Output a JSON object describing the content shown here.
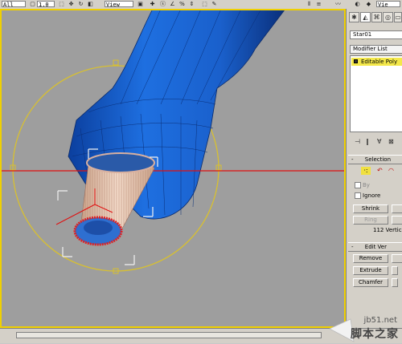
{
  "toolbar": {
    "filter_value": "All",
    "spinner_value": "1.0",
    "view_value": "View",
    "right_view_value": "Vie"
  },
  "command_panel": {
    "object_name": "Star01",
    "modifier_list_label": "Modifier List",
    "stack_item": "Editable Poly",
    "selection_rollout_title": "Selection",
    "by_label": "By",
    "ignore_label": "Ignore",
    "shrink_label": "Shrink",
    "ring_label": "Ring",
    "status_text": "112 Vertic",
    "edit_rollout_title": "Edit Ver",
    "remove_label": "Remove",
    "extrude_label": "Extrude",
    "chamfer_label": "Chamfer"
  },
  "watermark": {
    "url": "jb51.net",
    "text": "脚本之家"
  },
  "colors": {
    "model_blue": "#1e6fe0",
    "gizmo_yellow": "#d8c030",
    "axis_red": "#e01010",
    "selection_red": "#e02020",
    "viewport_gray": "#9e9e9e"
  },
  "icons": [
    "hammer-icon",
    "arrow-icon",
    "rotate-icon",
    "scale-icon",
    "pin-icon",
    "vertex-icon",
    "edge-icon"
  ]
}
